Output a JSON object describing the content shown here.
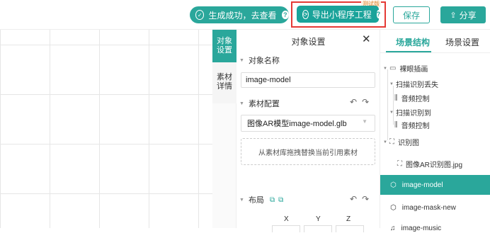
{
  "toolbar": {
    "success_label": "生成成功，去查看",
    "export_label": "导出小程序工程",
    "export_badge": "测试版",
    "save_label": "保存",
    "share_label": "分享"
  },
  "side_tabs": {
    "object_settings": "对象设置",
    "material_details": "素材详情"
  },
  "panel": {
    "title": "对象设置",
    "object_name_header": "对象名称",
    "object_name_value": "image-model",
    "material_header": "素材配置",
    "material_select_value": "图像AR模型image-model.glb",
    "drop_zone_text": "从素材库拖拽替换当前引用素材",
    "layout_header": "布局",
    "axes": [
      "X",
      "Y",
      "Z"
    ]
  },
  "scene": {
    "tabs": [
      "场景结构",
      "场景设置"
    ],
    "tree": {
      "root": "裸眼插画",
      "lost": "扫描识别丢失",
      "lost_audio": "音频控制",
      "found": "扫描识别到",
      "found_audio": "音频控制",
      "recog_group": "识别图",
      "recog_item": "图像AR识别图.jpg",
      "rows": [
        "image-model",
        "image-mask-new",
        "image-music"
      ]
    }
  },
  "colors": {
    "accent": "#2aa79b",
    "highlight_frame": "#e53935"
  }
}
